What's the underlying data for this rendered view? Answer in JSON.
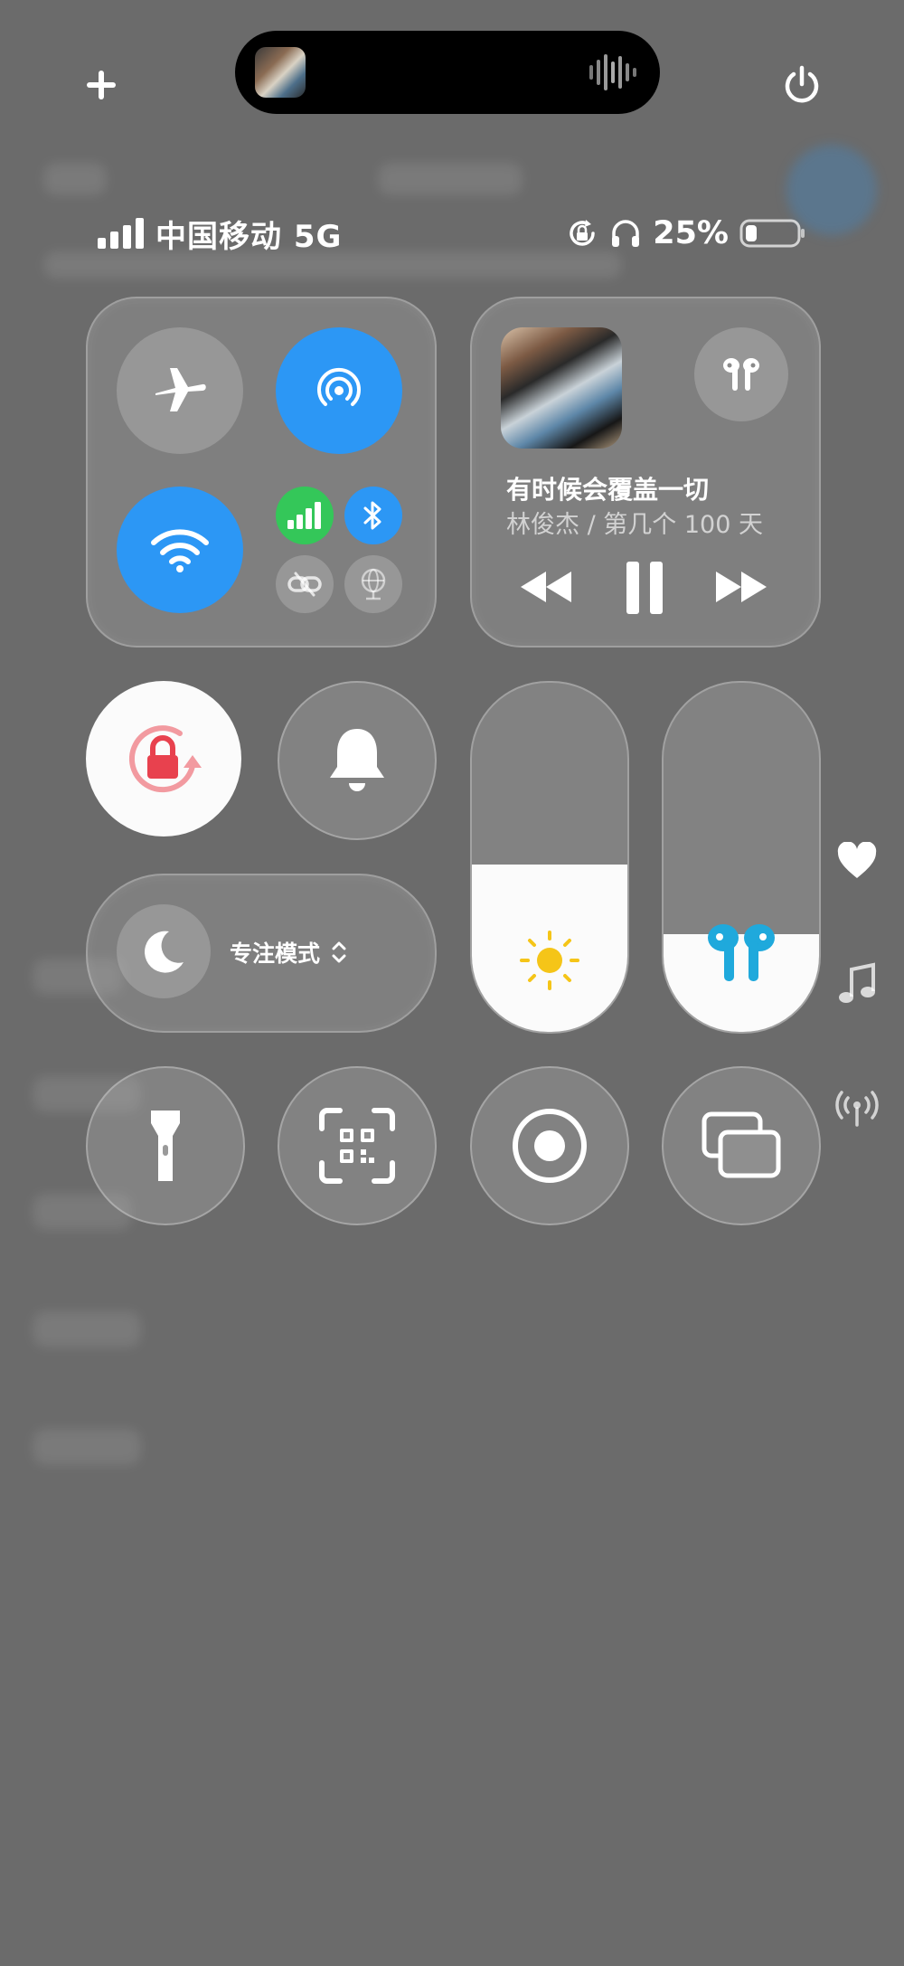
{
  "status_bar": {
    "carrier": "中国移动 5G",
    "battery_percent": "25%"
  },
  "dynamic_island": {
    "art_icon": "album-art",
    "activity_icon": "audio-wave-icon"
  },
  "top_buttons": {
    "add_icon": "plus-icon",
    "power_icon": "power-icon"
  },
  "connectivity": {
    "airplane_mode": false,
    "airdrop_on": true,
    "wifi_on": true,
    "cellular_on": true,
    "bluetooth_on": true,
    "hotspot_on": false,
    "vpn_on": false
  },
  "now_playing": {
    "title": "有时候会覆盖一切",
    "artist_album": "林俊杰 / 第几个 100 天",
    "output_icon": "airpods-icon",
    "playing": true
  },
  "controls": {
    "rotation_lock_on": true,
    "silent_mode": false,
    "focus_label": "专注模式"
  },
  "sliders": {
    "brightness_level": 0.48,
    "volume_level": 0.28
  },
  "colors": {
    "accent_blue": "#2c97f5",
    "cellular_green": "#34c759",
    "rotation_lock_red": "#e8414e",
    "airpods_blue": "#1fa9dc",
    "sun_yellow": "#f5c518"
  },
  "side_shortcuts": [
    "heart-icon",
    "music-note-icon",
    "antenna-icon"
  ]
}
